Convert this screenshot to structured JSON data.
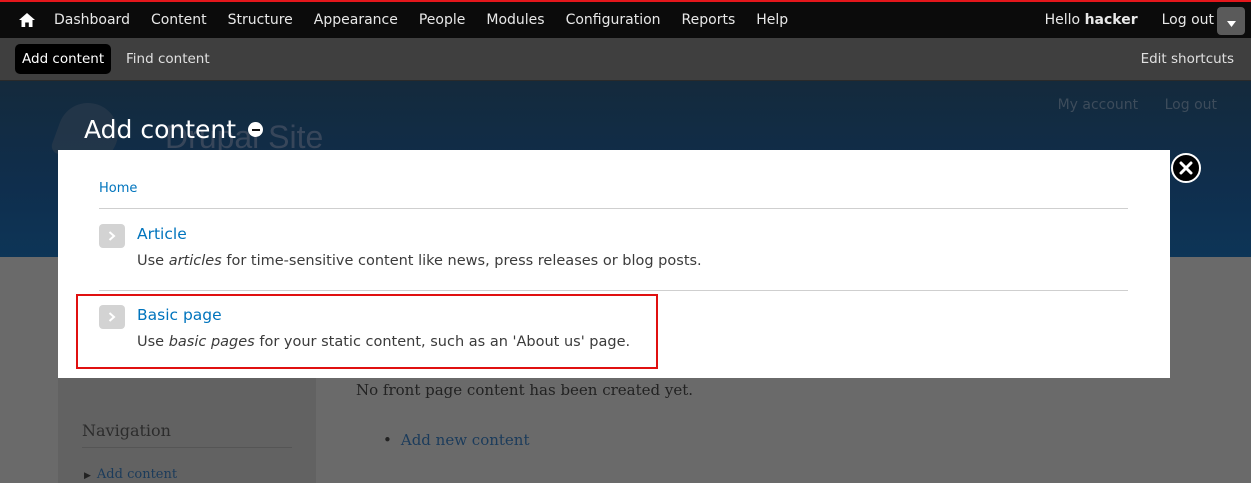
{
  "toolbar": {
    "items": [
      "Dashboard",
      "Content",
      "Structure",
      "Appearance",
      "People",
      "Modules",
      "Configuration",
      "Reports",
      "Help"
    ],
    "hello_prefix": "Hello",
    "username": "hacker",
    "logout": "Log out"
  },
  "shortcuts": {
    "add_content": "Add content",
    "find_content": "Find content",
    "edit_shortcuts": "Edit shortcuts"
  },
  "background": {
    "header_links": [
      "My account",
      "Log out"
    ],
    "site_name": "Drupal Site",
    "front_message": "No front page content has been created yet.",
    "front_link": "Add new content",
    "nav_title": "Navigation",
    "nav_item": "Add content"
  },
  "overlay": {
    "title": "Add content",
    "breadcrumb": "Home",
    "items": [
      {
        "label": "Article",
        "desc_before": "Use ",
        "desc_em": "articles",
        "desc_after": " for time-sensitive content like news, press releases or blog posts."
      },
      {
        "label": "Basic page",
        "desc_before": "Use ",
        "desc_em": "basic pages",
        "desc_after": " for your static content, such as an 'About us' page."
      }
    ]
  },
  "colors": {
    "toolbar_bg": "#0b0b0b",
    "toolbar_accent": "#e4161b",
    "link": "#0074bd",
    "highlight": "#e01010"
  },
  "icons": [
    "home-icon",
    "chevron-down-icon",
    "shortcut-add-icon",
    "close-icon",
    "arrow-right-icon"
  ]
}
